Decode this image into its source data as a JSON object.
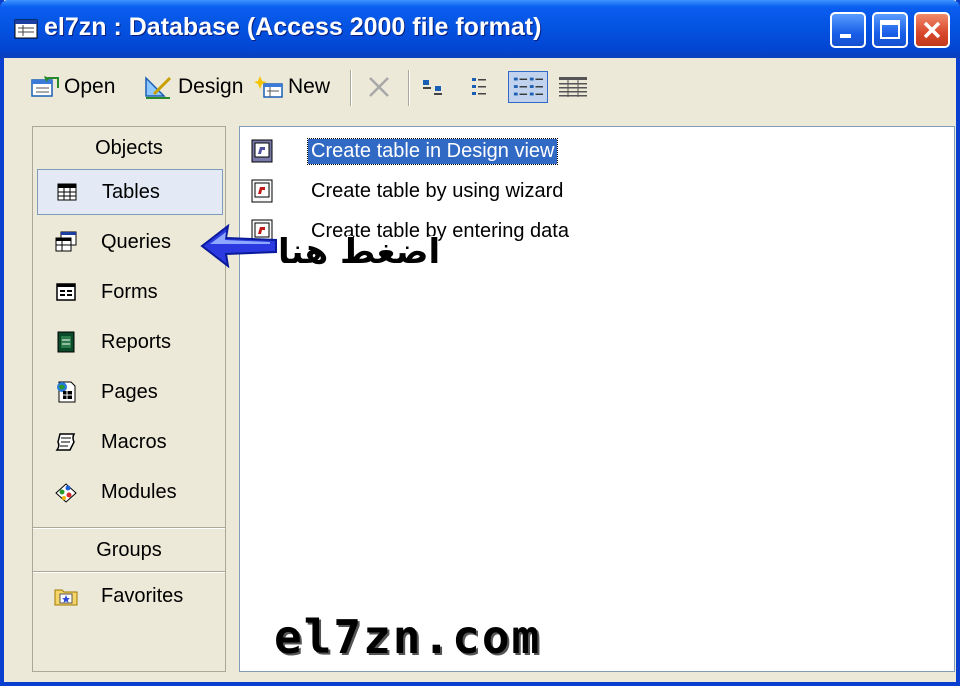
{
  "window": {
    "title": "el7zn : Database (Access 2000 file format)",
    "icon": "database-window-icon"
  },
  "title_buttons": [
    "minimize-icon",
    "maximize-icon",
    "close-icon"
  ],
  "toolbar": {
    "open_label": "Open",
    "design_label": "Design",
    "new_label": "New",
    "delete_icon": "delete-x-icon",
    "view_icons": [
      "large-icons-view-icon",
      "small-icons-view-icon",
      "list-view-icon",
      "details-view-icon"
    ],
    "active_view": "list-view-icon"
  },
  "sidebar": {
    "objects_header": "Objects",
    "items": [
      {
        "label": "Tables",
        "icon": "tables-icon",
        "selected": true
      },
      {
        "label": "Queries",
        "icon": "queries-icon"
      },
      {
        "label": "Forms",
        "icon": "forms-icon"
      },
      {
        "label": "Reports",
        "icon": "reports-icon"
      },
      {
        "label": "Pages",
        "icon": "pages-icon"
      },
      {
        "label": "Macros",
        "icon": "macros-icon"
      },
      {
        "label": "Modules",
        "icon": "modules-icon"
      }
    ],
    "groups_header": "Groups",
    "groups": [
      {
        "label": "Favorites",
        "icon": "favorites-folder-icon"
      }
    ]
  },
  "content": {
    "items": [
      {
        "label": "Create table in Design view",
        "icon": "design-view-shortcut-icon",
        "selected": true
      },
      {
        "label": "Create table by using wizard",
        "icon": "wizard-shortcut-icon"
      },
      {
        "label": "Create table by entering data",
        "icon": "datasheet-shortcut-icon"
      }
    ]
  },
  "annotation": {
    "arrow_icon": "blue-arrow-left-icon",
    "text": "اضغط هنا"
  },
  "watermark": "el7zn.com",
  "colors": {
    "titlebar": "#0552e0",
    "selection": "#316ac5",
    "close_button": "#d8472a",
    "window_bg": "#ece9d8"
  }
}
